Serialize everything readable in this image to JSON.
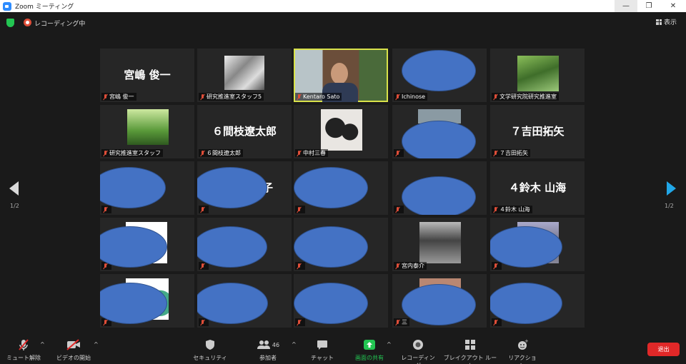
{
  "window": {
    "title": "Zoom ミーティング",
    "minimize": "—",
    "maximize": "❐",
    "close": "✕"
  },
  "status": {
    "recording": "レコーディング中",
    "view_label": "表示"
  },
  "pager": {
    "left": "1/2",
    "right": "1/2"
  },
  "tiles": [
    {
      "big": "宮嶋 俊一",
      "label": "宮嶋 俊一"
    },
    {
      "big": "",
      "label": "研究推進室スタッフ5"
    },
    {
      "big": "",
      "label": "Kentaro Sato"
    },
    {
      "big": "",
      "label": "Ichinose"
    },
    {
      "big": "",
      "label": "文学研究院研究推進室"
    },
    {
      "big": "",
      "label": "研究推進室スタッフ"
    },
    {
      "big": "６間枝遼太郎",
      "label": "６間枝遼太郎"
    },
    {
      "big": "",
      "label": "中村三春"
    },
    {
      "big": "",
      "label": ""
    },
    {
      "big": "７吉田拓矢",
      "label": "７吉田拓矢"
    },
    {
      "big": "",
      "label": ""
    },
    {
      "big": "子",
      "label": ""
    },
    {
      "big": "",
      "label": ""
    },
    {
      "big": "",
      "label": ""
    },
    {
      "big": "４鈴木 山海",
      "label": "４鈴木 山海"
    },
    {
      "big": "",
      "label": ""
    },
    {
      "big": "",
      "label": ""
    },
    {
      "big": "",
      "label": ""
    },
    {
      "big": "",
      "label": "宮内泰介"
    },
    {
      "big": "",
      "label": ""
    },
    {
      "big": "",
      "label": ""
    },
    {
      "big": "",
      "label": ""
    },
    {
      "big": "",
      "label": ""
    },
    {
      "big": "",
      "label": "三"
    },
    {
      "big": "",
      "label": ""
    }
  ],
  "toolbar": {
    "mute": "ミュート解除",
    "video": "ビデオの開始",
    "security": "セキュリティ",
    "participants": "参加者",
    "participants_count": "46",
    "chat": "チャット",
    "share": "画面の共有",
    "record": "レコーディング",
    "breakout": "ブレイクアウト ルーム",
    "reactions": "リアクション",
    "leave": "退出",
    "caret": "^"
  },
  "colors": {
    "accent": "#23c552",
    "leave": "#e02828",
    "active_border": "#d9e24a",
    "redaction": "#4472c4",
    "nav_next": "#21a7e8"
  },
  "icons": [
    "zoom-logo-icon",
    "shield-icon",
    "record-icon",
    "grid-icon",
    "mic-muted-icon",
    "video-off-icon",
    "security-shield-icon",
    "participants-icon",
    "chat-icon",
    "share-screen-icon",
    "record-button-icon",
    "breakout-icon",
    "reaction-icon"
  ]
}
